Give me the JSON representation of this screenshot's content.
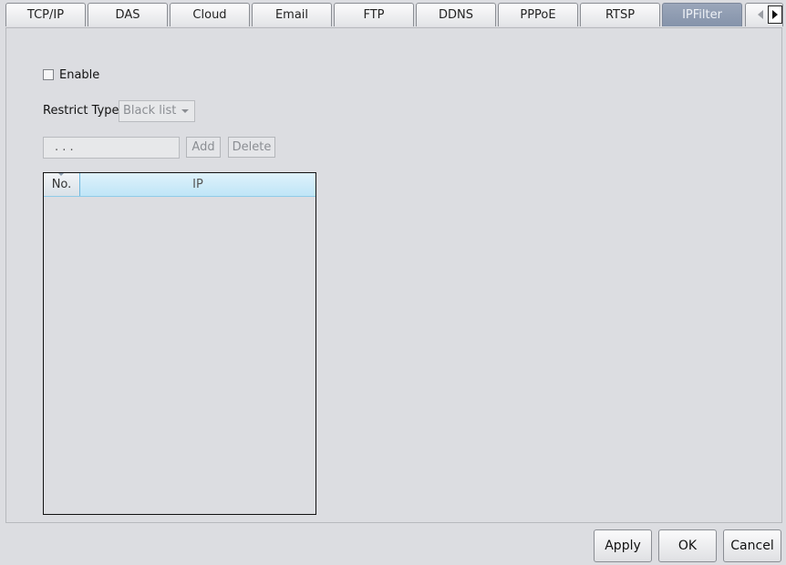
{
  "tabs": [
    {
      "label": "TCP/IP"
    },
    {
      "label": "DAS"
    },
    {
      "label": "Cloud"
    },
    {
      "label": "Email"
    },
    {
      "label": "FTP"
    },
    {
      "label": "DDNS"
    },
    {
      "label": "PPPoE"
    },
    {
      "label": "RTSP"
    },
    {
      "label": "IPFilter",
      "active": true
    }
  ],
  "form": {
    "enable_label": "Enable",
    "enable_checked": false,
    "restrict_type_label": "Restrict Type",
    "restrict_type_value": "Black list",
    "ip_input_value": ". . .",
    "add_label": "Add",
    "delete_label": "Delete"
  },
  "table": {
    "columns": [
      "No.",
      "IP"
    ],
    "rows": []
  },
  "footer": {
    "apply_label": "Apply",
    "ok_label": "OK",
    "cancel_label": "Cancel"
  },
  "icons": {
    "tab_scroll_left": "arrow-left-icon",
    "tab_scroll_right": "arrow-right-icon",
    "select_dropdown": "chevron-down-icon",
    "column_sort": "sort-indicator-icon"
  },
  "colors": {
    "active_tab": "#8f9bb0",
    "table_header_ip": "#c8e9f8",
    "background": "#dcdde1"
  }
}
